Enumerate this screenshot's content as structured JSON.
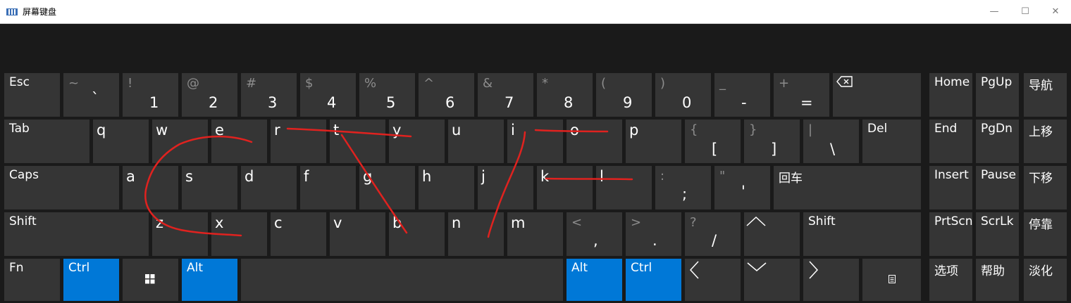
{
  "window": {
    "title": "屏幕键盘",
    "minimize": "—",
    "maximize": "☐",
    "close": "✕"
  },
  "keys": {
    "esc": "Esc",
    "tilde": {
      "shift": "~",
      "main": "`"
    },
    "d1": {
      "shift": "!",
      "main": "1"
    },
    "d2": {
      "shift": "@",
      "main": "2"
    },
    "d3": {
      "shift": "#",
      "main": "3"
    },
    "d4": {
      "shift": "$",
      "main": "4"
    },
    "d5": {
      "shift": "%",
      "main": "5"
    },
    "d6": {
      "shift": "^",
      "main": "6"
    },
    "d7": {
      "shift": "&",
      "main": "7"
    },
    "d8": {
      "shift": "*",
      "main": "8"
    },
    "d9": {
      "shift": "(",
      "main": "9"
    },
    "d0": {
      "shift": ")",
      "main": "0"
    },
    "minus": {
      "shift": "_",
      "main": "-"
    },
    "equals": {
      "shift": "+",
      "main": "="
    },
    "backspace_icon": "backspace-icon",
    "home": "Home",
    "pgup": "PgUp",
    "nav": "导航",
    "tab": "Tab",
    "q": "q",
    "w": "w",
    "e": "e",
    "r": "r",
    "t": "t",
    "y": "y",
    "u": "u",
    "i": "i",
    "o": "o",
    "p": "p",
    "lbracket": {
      "shift": "{",
      "main": "["
    },
    "rbracket": {
      "shift": "}",
      "main": "]"
    },
    "backslash": {
      "shift": "|",
      "main": "\\"
    },
    "del": "Del",
    "end": "End",
    "pgdn": "PgDn",
    "moveup": "上移",
    "caps": "Caps",
    "a": "a",
    "s": "s",
    "d": "d",
    "f": "f",
    "g": "g",
    "h": "h",
    "j": "j",
    "k": "k",
    "l": "l",
    "semicolon": {
      "shift": ":",
      "main": ";"
    },
    "quote": {
      "shift": "\"",
      "main": "'"
    },
    "enter": "回车",
    "insert": "Insert",
    "pause": "Pause",
    "movedown": "下移",
    "lshift": "Shift",
    "z": "z",
    "x": "x",
    "c": "c",
    "v": "v",
    "b": "b",
    "n": "n",
    "m": "m",
    "comma": {
      "shift": "<",
      "main": ","
    },
    "period": {
      "shift": ">",
      "main": "."
    },
    "slash": {
      "shift": "?",
      "main": "/"
    },
    "rshift": "Shift",
    "prtscn": "PrtScn",
    "scrlk": "ScrLk",
    "dock": "停靠",
    "fn": "Fn",
    "lctrl": "Ctrl",
    "lalt": "Alt",
    "ralt": "Alt",
    "rctrl": "Ctrl",
    "options": "选项",
    "help": "帮助",
    "fade": "淡化"
  },
  "colors": {
    "background": "#1a1a1a",
    "key": "#353535",
    "key_active": "#0078d7",
    "ink": "#e0221f"
  }
}
